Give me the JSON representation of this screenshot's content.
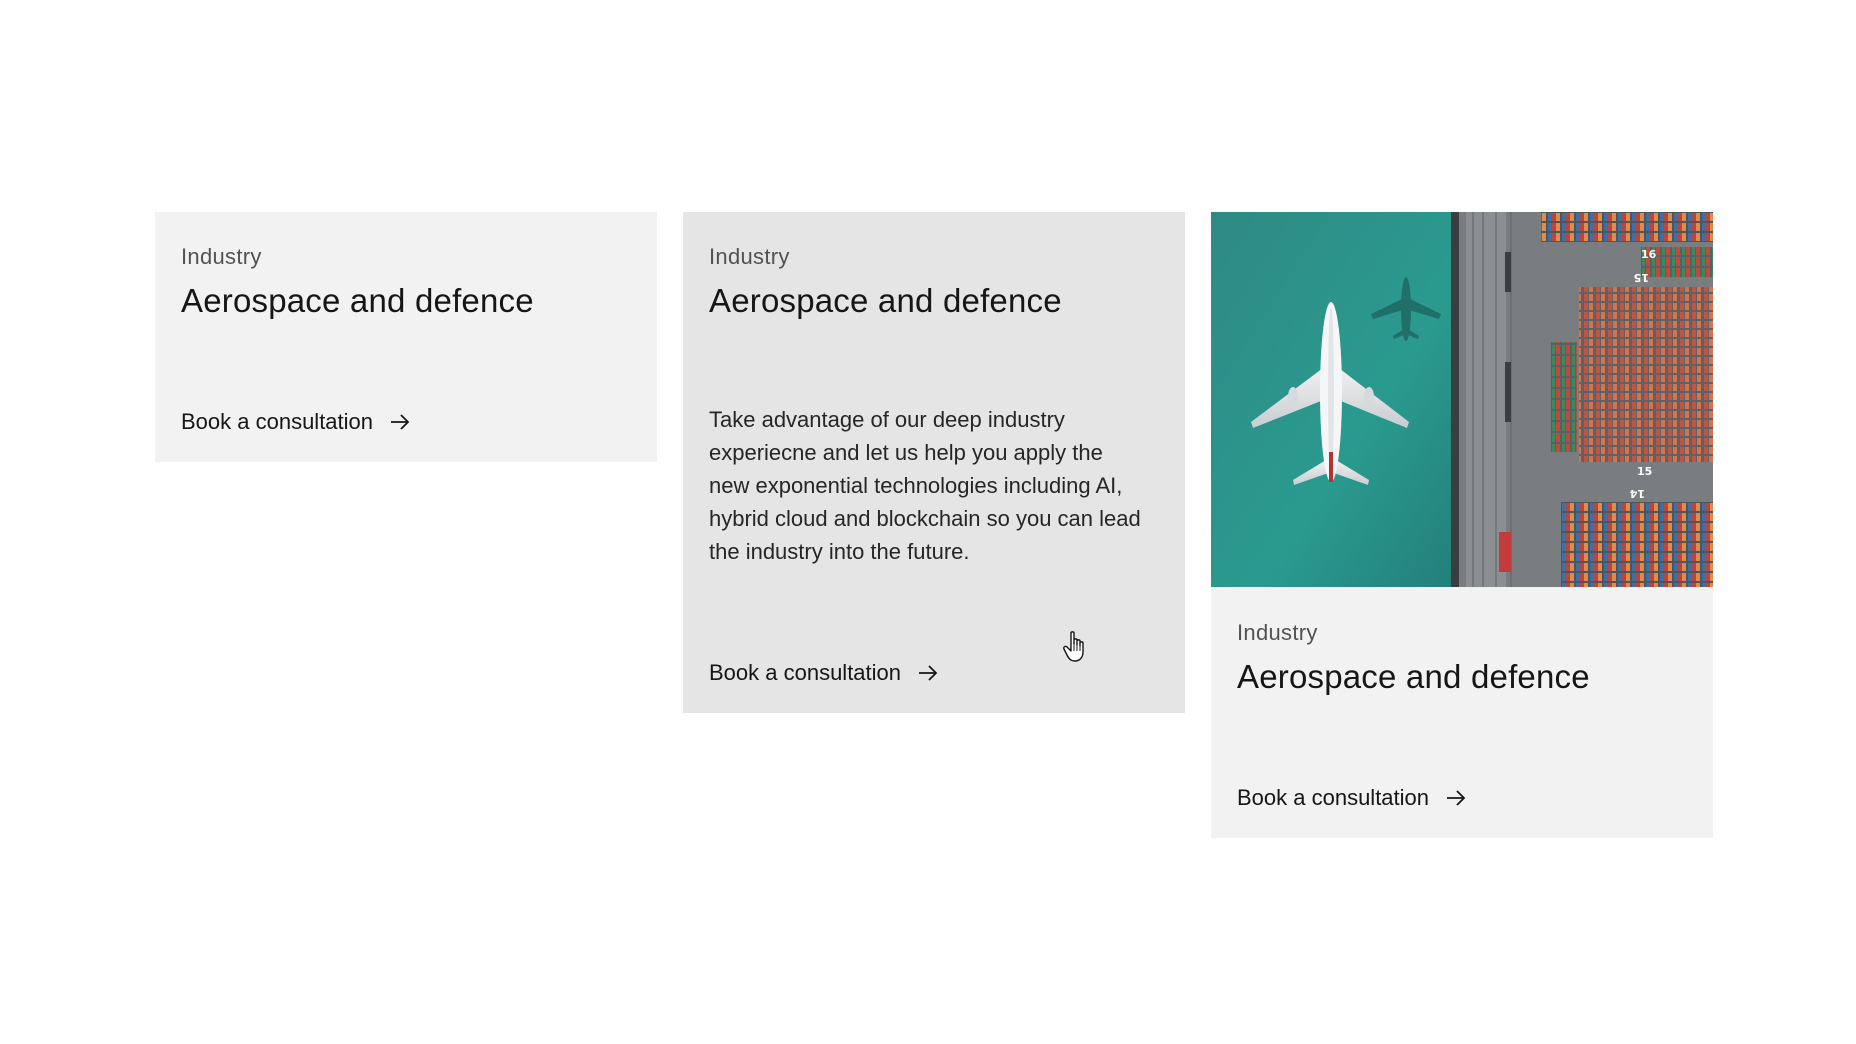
{
  "cards": [
    {
      "eyebrow": "Industry",
      "heading": "Aerospace and defence",
      "cta_label": "Book a consultation",
      "cta_icon": "arrow-right-icon"
    },
    {
      "eyebrow": "Industry",
      "heading": "Aerospace and defence",
      "body": "Take advantage of our deep industry experiecne and let us help you apply the new exponential technologies including AI, hybrid cloud and blockchain so you can lead the industry into the future.",
      "cta_label": "Book a consultation",
      "cta_icon": "arrow-right-icon",
      "state": "hover"
    },
    {
      "image": "airplane-over-shipping-port",
      "eyebrow": "Industry",
      "heading": "Aerospace and defence",
      "cta_label": "Book a consultation",
      "cta_icon": "arrow-right-icon"
    }
  ],
  "image_labels": [
    "16",
    "15",
    "15",
    "14"
  ],
  "colors": {
    "card_bg": "#f2f2f2",
    "card_hover_bg": "#e5e5e5",
    "text_primary": "#161616",
    "text_secondary": "#525252",
    "water": "#2e8f87"
  },
  "cursor": "hand-pointer-icon"
}
